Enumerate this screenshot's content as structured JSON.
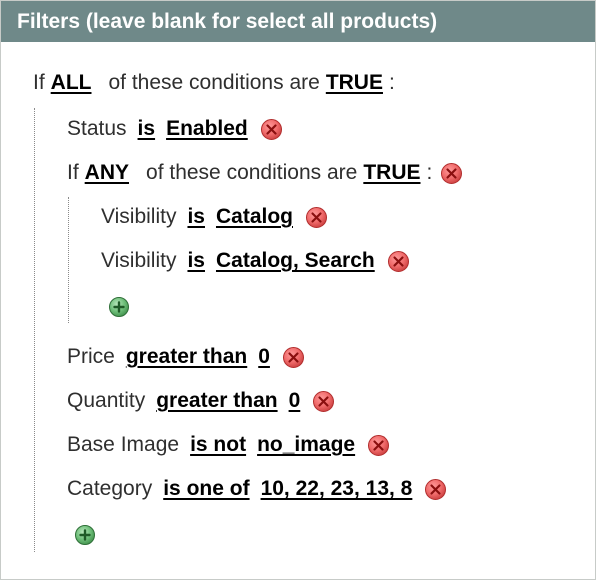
{
  "panel": {
    "title": "Filters (leave blank for select all products)"
  },
  "root": {
    "prefix": "If",
    "aggregator": "ALL",
    "middle": "of these conditions are",
    "value": "TRUE",
    "suffix": ":"
  },
  "conditions": {
    "status": {
      "attribute": "Status",
      "operator": "is",
      "value": "Enabled"
    },
    "any_group": {
      "prefix": "If",
      "aggregator": "ANY",
      "middle": "of these conditions are",
      "value": "TRUE",
      "suffix": ":",
      "items": [
        {
          "attribute": "Visibility",
          "operator": "is",
          "value": "Catalog"
        },
        {
          "attribute": "Visibility",
          "operator": "is",
          "value": "Catalog, Search"
        }
      ]
    },
    "price": {
      "attribute": "Price",
      "operator": "greater than",
      "value": "0"
    },
    "quantity": {
      "attribute": "Quantity",
      "operator": "greater than",
      "value": "0"
    },
    "base_image": {
      "attribute": "Base Image",
      "operator": "is not",
      "value": "no_image"
    },
    "category": {
      "attribute": "Category",
      "operator": "is one of",
      "value": "10, 22, 23, 13, 8"
    }
  },
  "icons": {
    "remove": "remove-condition-icon",
    "add": "add-condition-icon"
  },
  "colors": {
    "header_bg": "#6f8989",
    "header_text": "#ffffff",
    "remove_red": "#d0021b",
    "add_green": "#3f8f4a"
  }
}
